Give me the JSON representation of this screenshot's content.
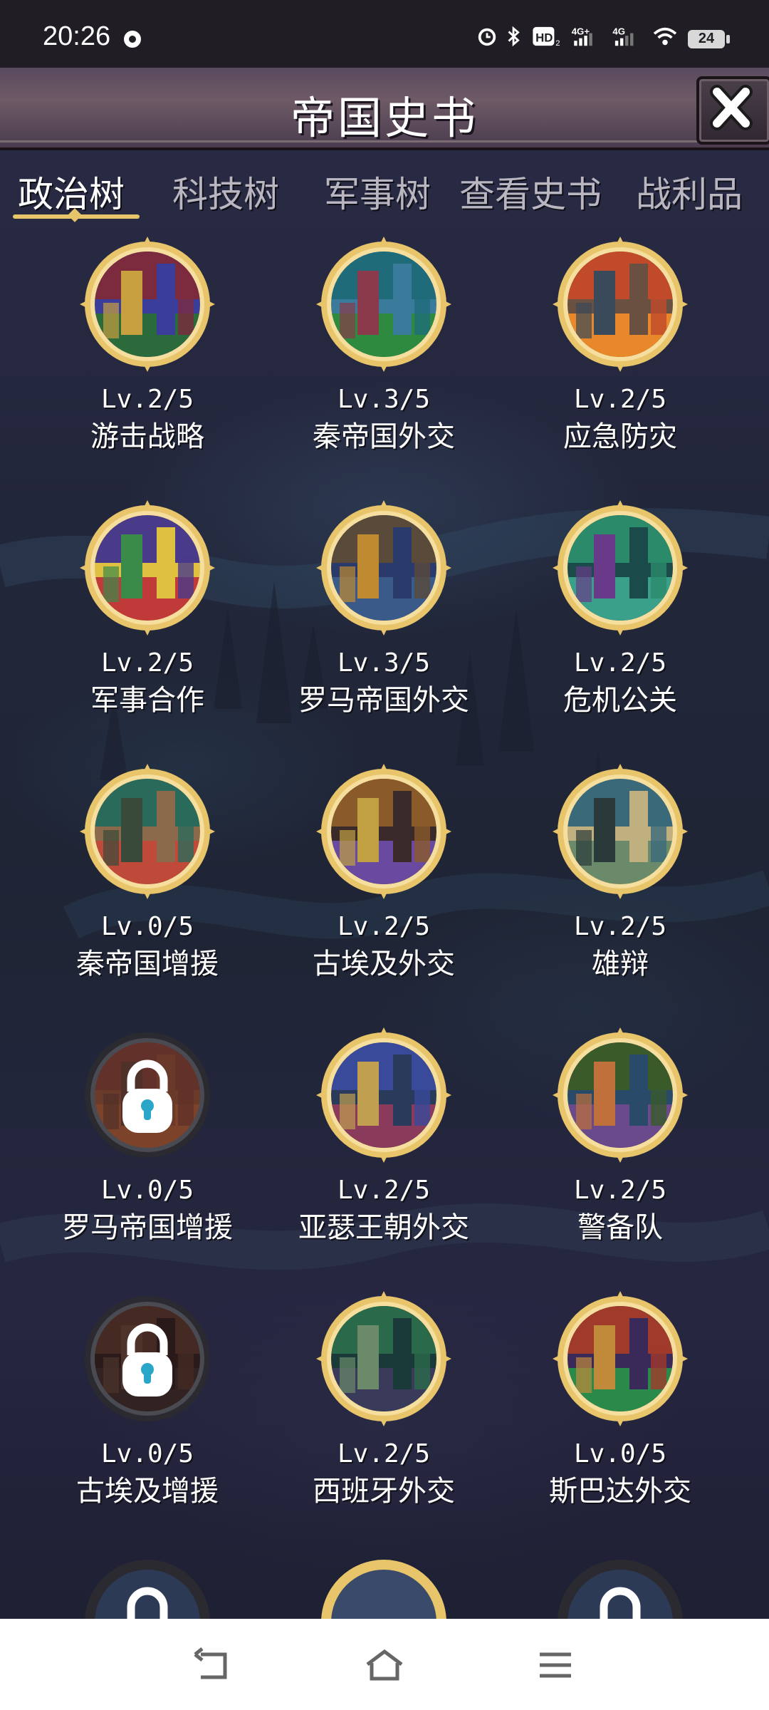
{
  "status_bar": {
    "time": "20:26",
    "battery": "24",
    "icons": [
      "alarm-icon",
      "bluetooth-icon",
      "hd-icon",
      "signal-4g-icon",
      "signal-4g-icon",
      "wifi-icon",
      "battery-icon"
    ]
  },
  "header": {
    "title": "帝国史书",
    "close_icon": "close-icon"
  },
  "tabs": [
    {
      "label": "政治树",
      "active": true
    },
    {
      "label": "科技树",
      "active": false
    },
    {
      "label": "军事树",
      "active": false
    },
    {
      "label": "查看史书",
      "active": false
    },
    {
      "label": "战利品",
      "active": false
    }
  ],
  "items": [
    {
      "level": "Lv.2/5",
      "name": "游击战略",
      "locked": false
    },
    {
      "level": "Lv.3/5",
      "name": "秦帝国外交",
      "locked": false
    },
    {
      "level": "Lv.2/5",
      "name": "应急防灾",
      "locked": false
    },
    {
      "level": "Lv.2/5",
      "name": "军事合作",
      "locked": false
    },
    {
      "level": "Lv.3/5",
      "name": "罗马帝国外交",
      "locked": false
    },
    {
      "level": "Lv.2/5",
      "name": "危机公关",
      "locked": false
    },
    {
      "level": "Lv.0/5",
      "name": "秦帝国增援",
      "locked": false
    },
    {
      "level": "Lv.2/5",
      "name": "古埃及外交",
      "locked": false
    },
    {
      "level": "Lv.2/5",
      "name": "雄辩",
      "locked": false
    },
    {
      "level": "Lv.0/5",
      "name": "罗马帝国增援",
      "locked": true
    },
    {
      "level": "Lv.2/5",
      "name": "亚瑟王朝外交",
      "locked": false
    },
    {
      "level": "Lv.2/5",
      "name": "警备队",
      "locked": false
    },
    {
      "level": "Lv.0/5",
      "name": "古埃及增援",
      "locked": true
    },
    {
      "level": "Lv.2/5",
      "name": "西班牙外交",
      "locked": false
    },
    {
      "level": "Lv.0/5",
      "name": "斯巴达外交",
      "locked": false
    }
  ],
  "colors": {
    "gold": "#e8c56a",
    "active_tab_underline": "#e6c46a",
    "lock": "#ffffff",
    "lock_keyhole": "#2aa6c8"
  },
  "navbar": {
    "icons": [
      "back-icon",
      "home-icon",
      "menu-icon"
    ]
  }
}
